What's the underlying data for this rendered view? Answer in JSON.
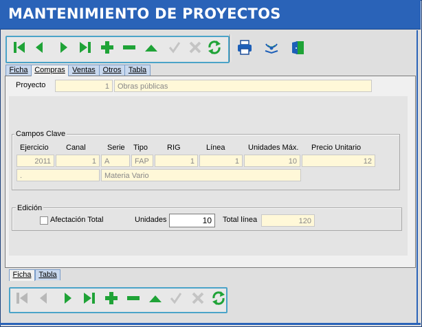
{
  "window": {
    "title": "MANTENIMIENTO DE PROYECTOS"
  },
  "colors": {
    "title_bar": "#2a63b8",
    "toolbar_border": "#4aa3c8",
    "readonly_field": "#fff8d8",
    "nav_green": "#1fa337"
  },
  "toolbar_top": {
    "buttons": [
      {
        "name": "first-record-icon",
        "enabled": true
      },
      {
        "name": "previous-record-icon",
        "enabled": true
      },
      {
        "name": "next-record-icon",
        "enabled": true
      },
      {
        "name": "last-record-icon",
        "enabled": true
      },
      {
        "name": "add-record-icon",
        "enabled": true
      },
      {
        "name": "delete-record-icon",
        "enabled": true
      },
      {
        "name": "edit-record-icon",
        "enabled": true
      },
      {
        "name": "confirm-icon",
        "enabled": false
      },
      {
        "name": "cancel-icon",
        "enabled": false
      },
      {
        "name": "refresh-icon",
        "enabled": true
      },
      {
        "name": "printer-icon",
        "enabled": true
      },
      {
        "name": "signal-icon",
        "enabled": true
      },
      {
        "name": "exit-door-icon",
        "enabled": true
      }
    ]
  },
  "tabs_top": [
    {
      "label": "Ficha",
      "active": false
    },
    {
      "label": "Compras",
      "active": true
    },
    {
      "label": "Ventas",
      "active": false
    },
    {
      "label": "Otros",
      "active": false
    },
    {
      "label": "Tabla",
      "active": false
    }
  ],
  "proyecto": {
    "label": "Proyecto",
    "code": "1",
    "name": "Obras públicas"
  },
  "campos_clave": {
    "title": "Campos Clave",
    "headers": {
      "ejercicio": "Ejercicio",
      "canal": "Canal",
      "serie": "Serie",
      "tipo": "Tipo",
      "rig": "RIG",
      "linea": "Línea",
      "unidades_max": "Unidades Máx.",
      "precio_unitario": "Precio Unitario"
    },
    "values": {
      "ejercicio": "2011",
      "canal": "1",
      "serie": "A",
      "tipo": "FAP",
      "rig": "1",
      "linea": "1",
      "unidades_max": "10",
      "precio_unitario": "12"
    },
    "item_code": ".",
    "item_desc": "Materia Vario"
  },
  "edicion": {
    "title": "Edición",
    "afectacion_label": "Afectación Total",
    "afectacion_checked": false,
    "unidades_label": "Unidades",
    "unidades_value": "10",
    "total_linea_label": "Total línea",
    "total_linea_value": "120"
  },
  "tabs_bottom": [
    {
      "label": "Ficha",
      "active": true
    },
    {
      "label": "Tabla",
      "active": false
    }
  ],
  "toolbar_bottom": {
    "buttons": [
      {
        "name": "first-record-icon",
        "enabled": false
      },
      {
        "name": "previous-record-icon",
        "enabled": false
      },
      {
        "name": "next-record-icon",
        "enabled": true
      },
      {
        "name": "last-record-icon",
        "enabled": true
      },
      {
        "name": "add-record-icon",
        "enabled": true
      },
      {
        "name": "delete-record-icon",
        "enabled": true
      },
      {
        "name": "edit-record-icon",
        "enabled": true
      },
      {
        "name": "confirm-icon",
        "enabled": false
      },
      {
        "name": "cancel-icon",
        "enabled": false
      },
      {
        "name": "refresh-icon",
        "enabled": true
      }
    ]
  }
}
